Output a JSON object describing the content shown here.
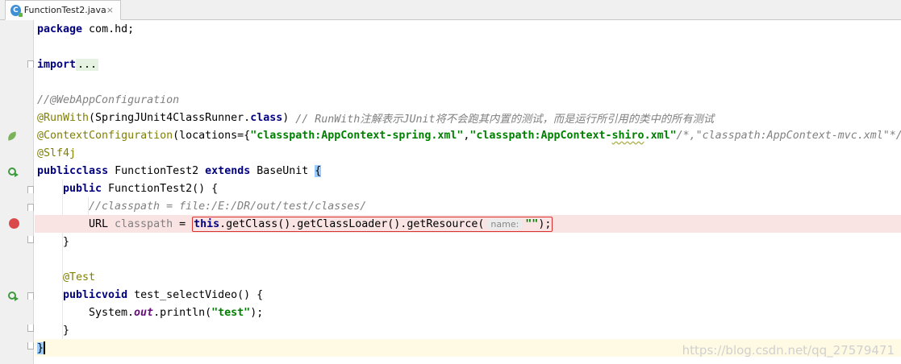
{
  "tab": {
    "filename": "FunctionTest2.java",
    "icon": "class-icon",
    "close": "×"
  },
  "code": {
    "package": {
      "kw": "package",
      "rest": " com.hd;"
    },
    "import": {
      "kw": "import",
      "dots": "..."
    },
    "c_webapp": "//@WebAppConfiguration",
    "runwith": {
      "ann": "@RunWith",
      "p1": "(SpringJUnit4ClassRunner.",
      "kw": "class",
      "p2": ") ",
      "cmt": "// RunWith注解表示JUnit将不会跑其内置的测试，而是运行所引用的类中的所有测试"
    },
    "ctxconf": {
      "ann": "@ContextConfiguration",
      "p1": "(locations={",
      "s1": "\"classpath:AppContext-spring.xml\"",
      "p2": ",",
      "s2a": "\"classpath:AppContext-",
      "s2b": "shiro",
      "s2c": ".xml\"",
      "cmt": "/*,\"classpath:AppContext-mvc.xml\"*/"
    },
    "slf4j": "@Slf4j",
    "classdecl": {
      "kw1": "public",
      "kw2": "class",
      "name": " FunctionTest2 ",
      "kw3": "extends",
      "base": " BaseUnit ",
      "brace": "{"
    },
    "ctor": {
      "kw": "public",
      "rest": " FunctionTest2() {"
    },
    "c_classpath": "//classpath = file:/E:/DR/out/test/classes/",
    "urlline": {
      "type": "URL ",
      "var": "classpath",
      "eq": " = ",
      "kw": "this",
      "call": ".getClass().getClassLoader().getResource(",
      "hint": "name:",
      "str": "\"\"",
      "end": ");"
    },
    "close1": "}",
    "test_ann": "@Test",
    "method": {
      "kw1": "public",
      "kw2": "void",
      "rest": " test_selectVideo() {"
    },
    "println": {
      "p1": "System.",
      "fld": "out",
      "p2": ".println(",
      "str": "\"test\"",
      "p3": ");"
    },
    "close2": "}",
    "close3": "}"
  },
  "watermark": "https://blog.csdn.net/qq_27579471"
}
